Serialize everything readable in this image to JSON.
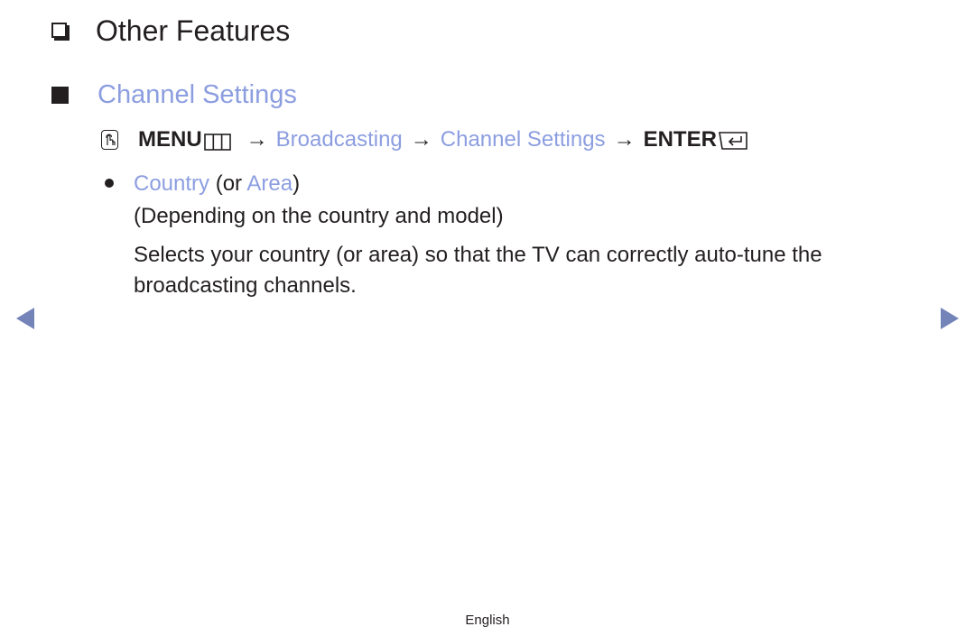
{
  "heading": {
    "icon": "hollow-square-icon",
    "title": "Other Features"
  },
  "section": {
    "icon": "filled-square-icon",
    "title": "Channel Settings"
  },
  "menu_path": {
    "icon": "hand-press-icon",
    "menu_label": "MENU",
    "menu_icon": "menu-grid-icon",
    "arrow": "→",
    "steps": [
      "Broadcasting",
      "Channel Settings"
    ],
    "enter_label": "ENTER",
    "enter_icon": "enter-return-icon"
  },
  "item": {
    "bullet_icon": "bullet-dot-icon",
    "name": "Country",
    "connector_open": " (or ",
    "alt_name": "Area",
    "connector_close": ")",
    "note": "(Depending on the country and model)",
    "description": "Selects your country (or area) so that the TV can correctly auto-tune the broadcasting channels."
  },
  "navigation": {
    "prev_icon": "triangle-left-icon",
    "next_icon": "triangle-right-icon"
  },
  "footer": {
    "language": "English"
  },
  "colors": {
    "accent": "#8c9ee0",
    "text": "#231f20",
    "nav_arrow": "#7484b8"
  }
}
